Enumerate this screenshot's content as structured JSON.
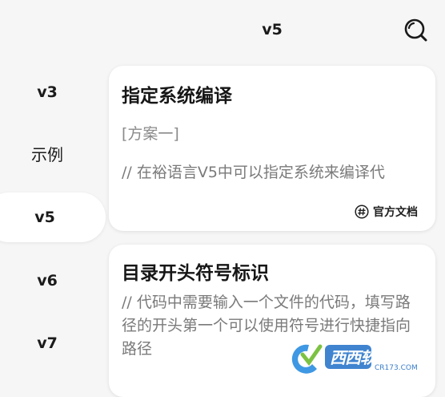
{
  "header": {
    "title": "v5"
  },
  "sidebar": {
    "items": [
      {
        "label": "v3",
        "active": false
      },
      {
        "label": "示例",
        "active": false
      },
      {
        "label": "v5",
        "active": true
      },
      {
        "label": "v6",
        "active": false
      },
      {
        "label": "v7",
        "active": false
      }
    ]
  },
  "cards": [
    {
      "title": "指定系统编译",
      "tag": "[方案一]",
      "description": "// 在裕语言V5中可以指定系统来编译代",
      "doc_link": "官方文档"
    },
    {
      "title": "目录开头符号标识",
      "description": "// 代码中需要输入一个文件的代码，填写路径的开头第一个可以使用符号进行快捷指向路径"
    }
  ],
  "watermark": {
    "text": "西西软件园",
    "subtext": "CR173.COM"
  },
  "colors": {
    "accent": "#1976d2",
    "background": "#f6f6f6",
    "card": "#ffffff"
  }
}
